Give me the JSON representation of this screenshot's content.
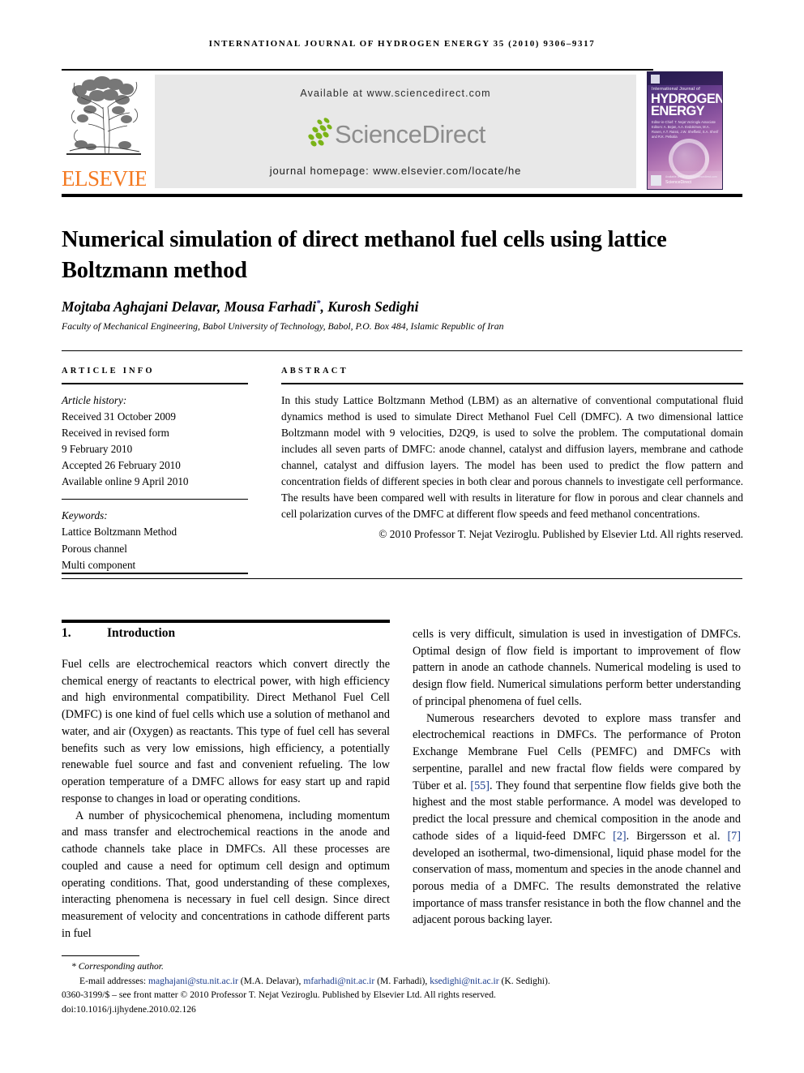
{
  "running_head": "INTERNATIONAL JOURNAL OF HYDROGEN ENERGY 35 (2010) 9306–9317",
  "masthead": {
    "publisher_logo_text": "ELSEVIER",
    "available_at": "Available at www.sciencedirect.com",
    "sciencedirect_logo_text": "ScienceDirect",
    "journal_homepage": "journal homepage: www.elsevier.com/locate/he",
    "cover": {
      "superline": "International Journal of",
      "line1": "HYDROGEN",
      "line2": "ENERGY",
      "editors": "Editor-in-Chief: T. Nejat Veziroglu\nAssociate Editors: A. Bejan, A.A. Evdokimov, M.A. Rosen, A.T. Raissi, J.W. Sheffield, S.A. Sherif and R.K. Petkalia",
      "footer_brand": "ScienceDirect",
      "footer_line": "Available online at www.sciencedirect.com"
    }
  },
  "article": {
    "title": "Numerical simulation of direct methanol fuel cells using lattice Boltzmann method",
    "authors": "Mojtaba Aghajani Delavar, Mousa Farhadi",
    "authors_tail": ", Kurosh Sedighi",
    "corresponding_marker": "*",
    "affiliation": "Faculty of Mechanical Engineering, Babol University of Technology, Babol, P.O. Box 484, Islamic Republic of Iran"
  },
  "info": {
    "heading": "ARTICLE INFO",
    "history_label": "Article history:",
    "history": [
      "Received 31 October 2009",
      "Received in revised form",
      "9 February 2010",
      "Accepted 26 February 2010",
      "Available online 9 April 2010"
    ],
    "keywords_label": "Keywords:",
    "keywords": [
      "Lattice Boltzmann Method",
      "Porous channel",
      "Multi component"
    ]
  },
  "abstract": {
    "heading": "ABSTRACT",
    "text": "In this study Lattice Boltzmann Method (LBM) as an alternative of conventional computational fluid dynamics method is used to simulate Direct Methanol Fuel Cell (DMFC). A two dimensional lattice Boltzmann model with 9 velocities, D2Q9, is used to solve the problem. The computational domain includes all seven parts of DMFC: anode channel, catalyst and diffusion layers, membrane and cathode channel, catalyst and diffusion layers. The model has been used to predict the flow pattern and concentration fields of different species in both clear and porous channels to investigate cell performance. The results have been compared well with results in literature for flow in porous and clear channels and cell polarization curves of the DMFC at different flow speeds and feed methanol concentrations.",
    "copyright": "© 2010 Professor T. Nejat Veziroglu. Published by Elsevier Ltd. All rights reserved."
  },
  "introduction": {
    "number": "1.",
    "title": "Introduction",
    "left_paragraphs": [
      "Fuel cells are electrochemical reactors which convert directly the chemical energy of reactants to electrical power, with high efficiency and high environmental compatibility. Direct Methanol Fuel Cell (DMFC) is one kind of fuel cells which use a solution of methanol and water, and air (Oxygen) as reactants. This type of fuel cell has several benefits such as very low emissions, high efficiency, a potentially renewable fuel source and fast and convenient refueling. The low operation temperature of a DMFC allows for easy start up and rapid response to changes in load or operating conditions.",
      "A number of physicochemical phenomena, including momentum and mass transfer and electrochemical reactions in the anode and cathode channels take place in DMFCs. All these processes are coupled and cause a need for optimum cell design and optimum operating conditions. That, good understanding of these complexes, interacting phenomena is necessary in fuel cell design. Since direct measurement of velocity and concentrations in cathode different parts in fuel"
    ],
    "right_paragraph_1": "cells is very difficult, simulation is used in investigation of DMFCs. Optimal design of flow field is important to improvement of flow pattern in anode an cathode channels. Numerical modeling is used to design flow field. Numerical simulations perform better understanding of principal phenomena of fuel cells.",
    "right_paragraph_2_parts": [
      "Numerous researchers devoted to explore mass transfer and electrochemical reactions in DMFCs. The performance of Proton Exchange Membrane Fuel Cells (PEMFC) and DMFCs with serpentine, parallel and new fractal flow fields were compared by Tüber et al. ",
      "[55]",
      ". They found that serpentine flow fields give both the highest and the most stable performance. A model was developed to predict the local pressure and chemical composition in the anode and cathode sides of a liquid-feed DMFC ",
      "[2]",
      ". Birgersson et al. ",
      "[7]",
      " developed an isothermal, two-dimensional, liquid phase model for the conservation of mass, momentum and species in the anode channel and porous media of a DMFC. The results demonstrated the relative importance of mass transfer resistance in both the flow channel and the adjacent porous backing layer."
    ]
  },
  "footnote": {
    "corresponding": "* Corresponding author.",
    "emails_label": "E-mail addresses:",
    "emails": [
      {
        "address": "maghajani@stu.nit.ac.ir",
        "person": "(M.A. Delavar)"
      },
      {
        "address": "mfarhadi@nit.ac.ir",
        "person": "(M. Farhadi)"
      },
      {
        "address": "ksedighi@nit.ac.ir",
        "person": "(K. Sedighi)"
      }
    ],
    "issn_line": "0360-3199/$ – see front matter © 2010 Professor T. Nejat Veziroglu. Published by Elsevier Ltd. All rights reserved.",
    "doi_line": "doi:10.1016/j.ijhydene.2010.02.126"
  },
  "colors": {
    "elsevier_orange": "#F47920",
    "sciencedirect_green": "#7AB317",
    "link_blue": "#1a3b8c",
    "banner_grey": "#e8e8e8"
  }
}
